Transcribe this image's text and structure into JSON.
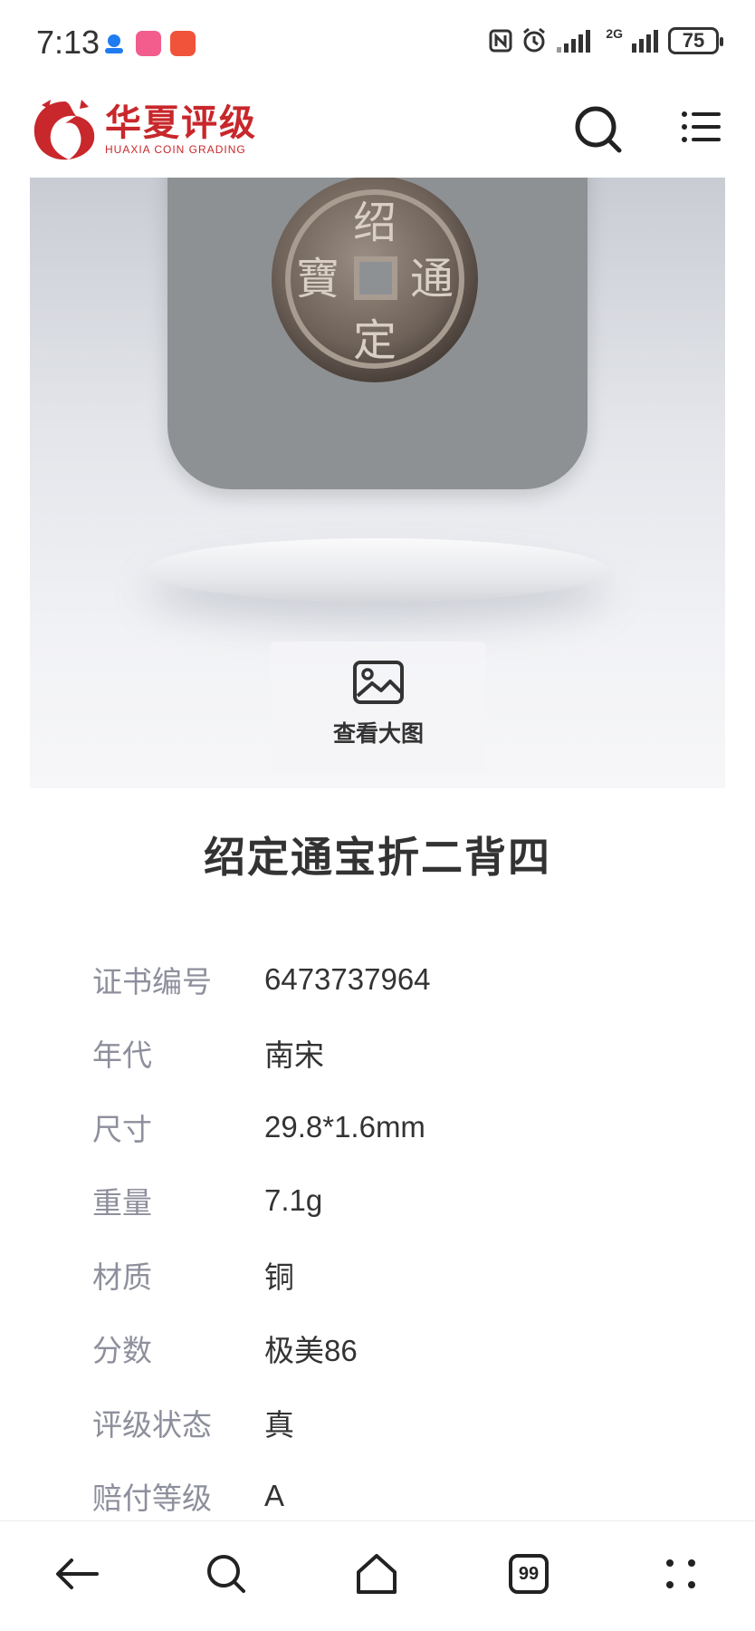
{
  "status_bar": {
    "time": "7:13",
    "battery": "75",
    "network": "2G"
  },
  "header": {
    "logo_cn": "华夏评级",
    "logo_en": "HUAXIA COIN GRADING",
    "brand_color": "#c8272b"
  },
  "hero": {
    "coin_characters": [
      "绍",
      "通",
      "定",
      "寶"
    ],
    "view_large_label": "查看大图"
  },
  "title": "绍定通宝折二背四",
  "details": [
    {
      "label": "证书编号",
      "value": "6473737964"
    },
    {
      "label": "年代",
      "value": "南宋"
    },
    {
      "label": "尺寸",
      "value": "29.8*1.6mm"
    },
    {
      "label": "重量",
      "value": "7.1g"
    },
    {
      "label": "材质",
      "value": "铜"
    },
    {
      "label": "分数",
      "value": "极美86"
    },
    {
      "label": "评级状态",
      "value": "真"
    },
    {
      "label": "赔付等级",
      "value": "A"
    }
  ],
  "bottom_nav": {
    "tabs_count": "99"
  }
}
